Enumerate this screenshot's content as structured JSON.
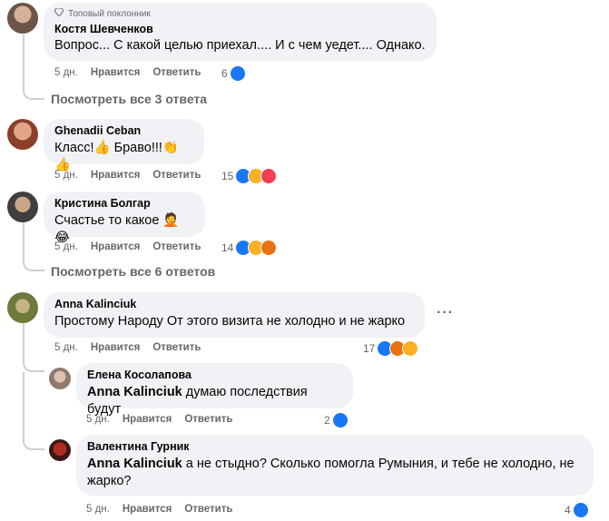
{
  "comments": [
    {
      "badge": "Топовый поклонник",
      "author": "Костя Шевченков",
      "text": "Вопрос... С какой целью приехал.... И с чем уедет.... Однако.",
      "time": "5 дн.",
      "like_label": "Нравится",
      "reply_label": "Ответить",
      "reaction_count": "6"
    },
    {
      "author": "Ghenadii Ceban",
      "text": "Класс!👍 Браво!!!👏👍",
      "time": "5 дн.",
      "like_label": "Нравится",
      "reply_label": "Ответить",
      "reaction_count": "15"
    },
    {
      "author": "Кристина Болгар",
      "text": "Счастье то какое 🤦😂",
      "time": "5 дн.",
      "like_label": "Нравится",
      "reply_label": "Ответить",
      "reaction_count": "14"
    },
    {
      "author": "Anna Kalinciuk",
      "text": "Простому Народу От этого визита не холодно и не жарко",
      "time": "5 дн.",
      "like_label": "Нравится",
      "reply_label": "Ответить",
      "reaction_count": "17",
      "more": "···"
    }
  ],
  "replies": [
    {
      "author": "Елена Косолапова",
      "mention": "Anna Kalinciuk",
      "text": " думаю последствия будут",
      "time": "5 дн.",
      "like_label": "Нравится",
      "reply_label": "Ответить",
      "reaction_count": "2"
    },
    {
      "author": "Валентина Гурник",
      "mention": "Anna Kalinciuk",
      "text": " а не стыдно? Сколько помогла Румыния, и тебе не холодно, не жарко?",
      "time": "5 дн.",
      "like_label": "Нравится",
      "reply_label": "Ответить",
      "reaction_count": "4"
    }
  ],
  "view_replies": {
    "first": "Посмотреть все 3 ответа",
    "second": "Посмотреть все 6 ответов"
  },
  "colors": {
    "bubble": "#f0f2f5",
    "secondary_text": "#65676b",
    "like": "#1877f2",
    "love": "#f33e58",
    "haha": "#f7b125",
    "angry": "#e9710f",
    "thread_line": "#ced0d4"
  }
}
